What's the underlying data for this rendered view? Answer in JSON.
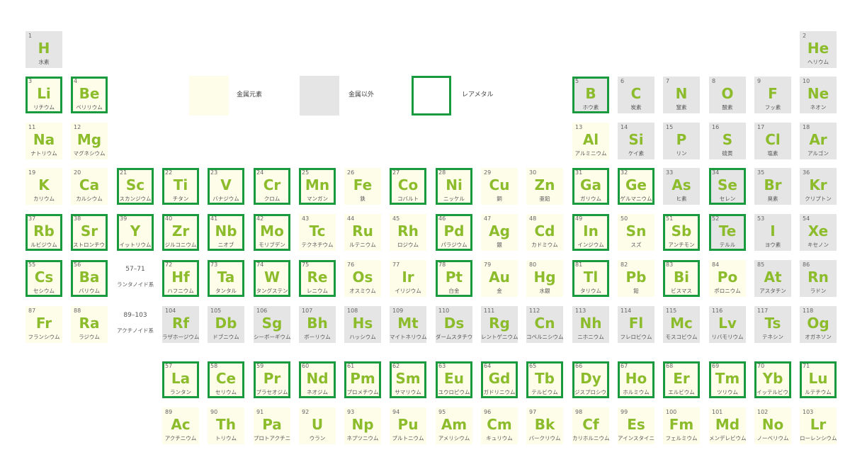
{
  "colors": {
    "metal_fill": "#fefdea",
    "nonmetal_fill": "#e5e5e5",
    "rare_border": "#1a9a3e",
    "symbol_text": "#8cbc2c"
  },
  "legend": [
    {
      "kind": "metal",
      "label": "金属元素"
    },
    {
      "kind": "nonmetal",
      "label": "金属以外"
    },
    {
      "kind": "rare",
      "label": "レアメタル"
    }
  ],
  "elements": [
    {
      "n": "1",
      "s": "H",
      "j": "水素",
      "c": "nonmetal",
      "r": false,
      "row": 1,
      "col": 1
    },
    {
      "n": "2",
      "s": "He",
      "j": "ヘリウム",
      "c": "nonmetal",
      "r": false,
      "row": 1,
      "col": 18
    },
    {
      "n": "3",
      "s": "Li",
      "j": "リチウム",
      "c": "metal",
      "r": true,
      "row": 2,
      "col": 1
    },
    {
      "n": "4",
      "s": "Be",
      "j": "ベリリウム",
      "c": "metal",
      "r": true,
      "row": 2,
      "col": 2
    },
    {
      "n": "5",
      "s": "B",
      "j": "ホウ素",
      "c": "nonmetal",
      "r": true,
      "row": 2,
      "col": 13
    },
    {
      "n": "6",
      "s": "C",
      "j": "炭素",
      "c": "nonmetal",
      "r": false,
      "row": 2,
      "col": 14
    },
    {
      "n": "7",
      "s": "N",
      "j": "窒素",
      "c": "nonmetal",
      "r": false,
      "row": 2,
      "col": 15
    },
    {
      "n": "8",
      "s": "O",
      "j": "酸素",
      "c": "nonmetal",
      "r": false,
      "row": 2,
      "col": 16
    },
    {
      "n": "9",
      "s": "F",
      "j": "フッ素",
      "c": "nonmetal",
      "r": false,
      "row": 2,
      "col": 17
    },
    {
      "n": "10",
      "s": "Ne",
      "j": "ネオン",
      "c": "nonmetal",
      "r": false,
      "row": 2,
      "col": 18
    },
    {
      "n": "11",
      "s": "Na",
      "j": "ナトリウム",
      "c": "metal",
      "r": false,
      "row": 3,
      "col": 1
    },
    {
      "n": "12",
      "s": "Mg",
      "j": "マグネシウム",
      "c": "metal",
      "r": false,
      "row": 3,
      "col": 2
    },
    {
      "n": "13",
      "s": "Al",
      "j": "アルミニウム",
      "c": "metal",
      "r": false,
      "row": 3,
      "col": 13
    },
    {
      "n": "14",
      "s": "Si",
      "j": "ケイ素",
      "c": "nonmetal",
      "r": false,
      "row": 3,
      "col": 14
    },
    {
      "n": "15",
      "s": "P",
      "j": "リン",
      "c": "nonmetal",
      "r": false,
      "row": 3,
      "col": 15
    },
    {
      "n": "16",
      "s": "S",
      "j": "硫黄",
      "c": "nonmetal",
      "r": false,
      "row": 3,
      "col": 16
    },
    {
      "n": "17",
      "s": "Cl",
      "j": "塩素",
      "c": "nonmetal",
      "r": false,
      "row": 3,
      "col": 17
    },
    {
      "n": "18",
      "s": "Ar",
      "j": "アルゴン",
      "c": "nonmetal",
      "r": false,
      "row": 3,
      "col": 18
    },
    {
      "n": "19",
      "s": "K",
      "j": "カリウム",
      "c": "metal",
      "r": false,
      "row": 4,
      "col": 1
    },
    {
      "n": "20",
      "s": "Ca",
      "j": "カルシウム",
      "c": "metal",
      "r": false,
      "row": 4,
      "col": 2
    },
    {
      "n": "21",
      "s": "Sc",
      "j": "スカンジウム",
      "c": "metal",
      "r": true,
      "row": 4,
      "col": 3
    },
    {
      "n": "22",
      "s": "Ti",
      "j": "チタン",
      "c": "metal",
      "r": true,
      "row": 4,
      "col": 4
    },
    {
      "n": "23",
      "s": "V",
      "j": "バナジウム",
      "c": "metal",
      "r": true,
      "row": 4,
      "col": 5
    },
    {
      "n": "24",
      "s": "Cr",
      "j": "クロム",
      "c": "metal",
      "r": true,
      "row": 4,
      "col": 6
    },
    {
      "n": "25",
      "s": "Mn",
      "j": "マンガン",
      "c": "metal",
      "r": true,
      "row": 4,
      "col": 7
    },
    {
      "n": "26",
      "s": "Fe",
      "j": "鉄",
      "c": "metal",
      "r": false,
      "row": 4,
      "col": 8
    },
    {
      "n": "27",
      "s": "Co",
      "j": "コバルト",
      "c": "metal",
      "r": true,
      "row": 4,
      "col": 9
    },
    {
      "n": "28",
      "s": "Ni",
      "j": "ニッケル",
      "c": "metal",
      "r": true,
      "row": 4,
      "col": 10
    },
    {
      "n": "29",
      "s": "Cu",
      "j": "銅",
      "c": "metal",
      "r": false,
      "row": 4,
      "col": 11
    },
    {
      "n": "30",
      "s": "Zn",
      "j": "亜鉛",
      "c": "metal",
      "r": false,
      "row": 4,
      "col": 12
    },
    {
      "n": "31",
      "s": "Ga",
      "j": "ガリウム",
      "c": "metal",
      "r": true,
      "row": 4,
      "col": 13
    },
    {
      "n": "32",
      "s": "Ge",
      "j": "ゲルマニウム",
      "c": "metal",
      "r": true,
      "row": 4,
      "col": 14
    },
    {
      "n": "33",
      "s": "As",
      "j": "ヒ素",
      "c": "nonmetal",
      "r": false,
      "row": 4,
      "col": 15
    },
    {
      "n": "34",
      "s": "Se",
      "j": "セレン",
      "c": "nonmetal",
      "r": true,
      "row": 4,
      "col": 16
    },
    {
      "n": "35",
      "s": "Br",
      "j": "臭素",
      "c": "nonmetal",
      "r": false,
      "row": 4,
      "col": 17
    },
    {
      "n": "36",
      "s": "Kr",
      "j": "クリプトン",
      "c": "nonmetal",
      "r": false,
      "row": 4,
      "col": 18
    },
    {
      "n": "37",
      "s": "Rb",
      "j": "ルビジウム",
      "c": "metal",
      "r": true,
      "row": 5,
      "col": 1
    },
    {
      "n": "38",
      "s": "Sr",
      "j": "ストロンチウム",
      "c": "metal",
      "r": true,
      "row": 5,
      "col": 2
    },
    {
      "n": "39",
      "s": "Y",
      "j": "イットリウム",
      "c": "metal",
      "r": true,
      "row": 5,
      "col": 3
    },
    {
      "n": "40",
      "s": "Zr",
      "j": "ジルコニウム",
      "c": "metal",
      "r": true,
      "row": 5,
      "col": 4
    },
    {
      "n": "41",
      "s": "Nb",
      "j": "ニオブ",
      "c": "metal",
      "r": true,
      "row": 5,
      "col": 5
    },
    {
      "n": "42",
      "s": "Mo",
      "j": "モリブデン",
      "c": "metal",
      "r": true,
      "row": 5,
      "col": 6
    },
    {
      "n": "43",
      "s": "Tc",
      "j": "テクネチウム",
      "c": "metal",
      "r": false,
      "row": 5,
      "col": 7
    },
    {
      "n": "44",
      "s": "Ru",
      "j": "ルテニウム",
      "c": "metal",
      "r": false,
      "row": 5,
      "col": 8
    },
    {
      "n": "45",
      "s": "Rh",
      "j": "ロジウム",
      "c": "metal",
      "r": false,
      "row": 5,
      "col": 9
    },
    {
      "n": "46",
      "s": "Pd",
      "j": "パラジウム",
      "c": "metal",
      "r": true,
      "row": 5,
      "col": 10
    },
    {
      "n": "47",
      "s": "Ag",
      "j": "銀",
      "c": "metal",
      "r": false,
      "row": 5,
      "col": 11
    },
    {
      "n": "48",
      "s": "Cd",
      "j": "カドミウム",
      "c": "metal",
      "r": false,
      "row": 5,
      "col": 12
    },
    {
      "n": "49",
      "s": "In",
      "j": "インジウム",
      "c": "metal",
      "r": true,
      "row": 5,
      "col": 13
    },
    {
      "n": "50",
      "s": "Sn",
      "j": "スズ",
      "c": "metal",
      "r": false,
      "row": 5,
      "col": 14
    },
    {
      "n": "51",
      "s": "Sb",
      "j": "アンチモン",
      "c": "metal",
      "r": true,
      "row": 5,
      "col": 15
    },
    {
      "n": "52",
      "s": "Te",
      "j": "テルル",
      "c": "nonmetal",
      "r": true,
      "row": 5,
      "col": 16
    },
    {
      "n": "53",
      "s": "I",
      "j": "ヨウ素",
      "c": "nonmetal",
      "r": false,
      "row": 5,
      "col": 17
    },
    {
      "n": "54",
      "s": "Xe",
      "j": "キセノン",
      "c": "nonmetal",
      "r": false,
      "row": 5,
      "col": 18
    },
    {
      "n": "55",
      "s": "Cs",
      "j": "セシウム",
      "c": "metal",
      "r": true,
      "row": 6,
      "col": 1
    },
    {
      "n": "56",
      "s": "Ba",
      "j": "バリウム",
      "c": "metal",
      "r": true,
      "row": 6,
      "col": 2
    },
    {
      "n": "57–71",
      "s": "",
      "j": "ランタノイド系",
      "c": "blank",
      "r": false,
      "row": 6,
      "col": 3,
      "range": true
    },
    {
      "n": "72",
      "s": "Hf",
      "j": "ハフニウム",
      "c": "metal",
      "r": true,
      "row": 6,
      "col": 4
    },
    {
      "n": "73",
      "s": "Ta",
      "j": "タンタル",
      "c": "metal",
      "r": true,
      "row": 6,
      "col": 5
    },
    {
      "n": "74",
      "s": "W",
      "j": "タングステン",
      "c": "metal",
      "r": true,
      "row": 6,
      "col": 6
    },
    {
      "n": "75",
      "s": "Re",
      "j": "レニウム",
      "c": "metal",
      "r": true,
      "row": 6,
      "col": 7
    },
    {
      "n": "76",
      "s": "Os",
      "j": "オスミウム",
      "c": "metal",
      "r": false,
      "row": 6,
      "col": 8
    },
    {
      "n": "77",
      "s": "Ir",
      "j": "イリジウム",
      "c": "metal",
      "r": false,
      "row": 6,
      "col": 9
    },
    {
      "n": "78",
      "s": "Pt",
      "j": "白金",
      "c": "metal",
      "r": true,
      "row": 6,
      "col": 10
    },
    {
      "n": "79",
      "s": "Au",
      "j": "金",
      "c": "metal",
      "r": false,
      "row": 6,
      "col": 11
    },
    {
      "n": "80",
      "s": "Hg",
      "j": "水銀",
      "c": "metal",
      "r": false,
      "row": 6,
      "col": 12
    },
    {
      "n": "81",
      "s": "Tl",
      "j": "タリウム",
      "c": "metal",
      "r": true,
      "row": 6,
      "col": 13
    },
    {
      "n": "82",
      "s": "Pb",
      "j": "鉛",
      "c": "metal",
      "r": false,
      "row": 6,
      "col": 14
    },
    {
      "n": "83",
      "s": "Bi",
      "j": "ビスマス",
      "c": "metal",
      "r": true,
      "row": 6,
      "col": 15
    },
    {
      "n": "84",
      "s": "Po",
      "j": "ポロニウム",
      "c": "metal",
      "r": false,
      "row": 6,
      "col": 16
    },
    {
      "n": "85",
      "s": "At",
      "j": "アスタチン",
      "c": "nonmetal",
      "r": false,
      "row": 6,
      "col": 17
    },
    {
      "n": "86",
      "s": "Rn",
      "j": "ラドン",
      "c": "nonmetal",
      "r": false,
      "row": 6,
      "col": 18
    },
    {
      "n": "87",
      "s": "Fr",
      "j": "フランシウム",
      "c": "metal",
      "r": false,
      "row": 7,
      "col": 1
    },
    {
      "n": "88",
      "s": "Ra",
      "j": "ラジウム",
      "c": "metal",
      "r": false,
      "row": 7,
      "col": 2
    },
    {
      "n": "89–103",
      "s": "",
      "j": "アクチノイド系",
      "c": "blank",
      "r": false,
      "row": 7,
      "col": 3,
      "range": true
    },
    {
      "n": "104",
      "s": "Rf",
      "j": "ラザホージウム",
      "c": "nonmetal",
      "r": false,
      "row": 7,
      "col": 4
    },
    {
      "n": "105",
      "s": "Db",
      "j": "ドブニウム",
      "c": "nonmetal",
      "r": false,
      "row": 7,
      "col": 5
    },
    {
      "n": "106",
      "s": "Sg",
      "j": "シーボーギウム",
      "c": "nonmetal",
      "r": false,
      "row": 7,
      "col": 6
    },
    {
      "n": "107",
      "s": "Bh",
      "j": "ボーリウム",
      "c": "nonmetal",
      "r": false,
      "row": 7,
      "col": 7
    },
    {
      "n": "108",
      "s": "Hs",
      "j": "ハッシウム",
      "c": "nonmetal",
      "r": false,
      "row": 7,
      "col": 8
    },
    {
      "n": "109",
      "s": "Mt",
      "j": "マイトネリウム",
      "c": "nonmetal",
      "r": false,
      "row": 7,
      "col": 9
    },
    {
      "n": "110",
      "s": "Ds",
      "j": "ダームスタチウム",
      "c": "nonmetal",
      "r": false,
      "row": 7,
      "col": 10
    },
    {
      "n": "111",
      "s": "Rg",
      "j": "レントゲニウム",
      "c": "nonmetal",
      "r": false,
      "row": 7,
      "col": 11
    },
    {
      "n": "112",
      "s": "Cn",
      "j": "コペルニシウム",
      "c": "nonmetal",
      "r": false,
      "row": 7,
      "col": 12
    },
    {
      "n": "113",
      "s": "Nh",
      "j": "ニホニウム",
      "c": "nonmetal",
      "r": false,
      "row": 7,
      "col": 13
    },
    {
      "n": "114",
      "s": "Fl",
      "j": "フレロビウム",
      "c": "nonmetal",
      "r": false,
      "row": 7,
      "col": 14
    },
    {
      "n": "115",
      "s": "Mc",
      "j": "モスコビウム",
      "c": "nonmetal",
      "r": false,
      "row": 7,
      "col": 15
    },
    {
      "n": "116",
      "s": "Lv",
      "j": "リバモリウム",
      "c": "nonmetal",
      "r": false,
      "row": 7,
      "col": 16
    },
    {
      "n": "117",
      "s": "Ts",
      "j": "テネシン",
      "c": "nonmetal",
      "r": false,
      "row": 7,
      "col": 17
    },
    {
      "n": "118",
      "s": "Og",
      "j": "オガネソン",
      "c": "nonmetal",
      "r": false,
      "row": 7,
      "col": 18
    },
    {
      "n": "57",
      "s": "La",
      "j": "ランタン",
      "c": "metal",
      "r": true,
      "row": 8,
      "col": 4
    },
    {
      "n": "58",
      "s": "Ce",
      "j": "セリウム",
      "c": "metal",
      "r": true,
      "row": 8,
      "col": 5
    },
    {
      "n": "59",
      "s": "Pr",
      "j": "プラセオジム",
      "c": "metal",
      "r": true,
      "row": 8,
      "col": 6
    },
    {
      "n": "60",
      "s": "Nd",
      "j": "ネオジム",
      "c": "metal",
      "r": true,
      "row": 8,
      "col": 7
    },
    {
      "n": "61",
      "s": "Pm",
      "j": "プロメチウム",
      "c": "metal",
      "r": true,
      "row": 8,
      "col": 8
    },
    {
      "n": "62",
      "s": "Sm",
      "j": "サマリウム",
      "c": "metal",
      "r": true,
      "row": 8,
      "col": 9
    },
    {
      "n": "63",
      "s": "Eu",
      "j": "ユウロピウム",
      "c": "metal",
      "r": true,
      "row": 8,
      "col": 10
    },
    {
      "n": "64",
      "s": "Gd",
      "j": "ガドリニウム",
      "c": "metal",
      "r": true,
      "row": 8,
      "col": 11
    },
    {
      "n": "65",
      "s": "Tb",
      "j": "テルビウム",
      "c": "metal",
      "r": true,
      "row": 8,
      "col": 12
    },
    {
      "n": "66",
      "s": "Dy",
      "j": "ジスプロシウム",
      "c": "metal",
      "r": true,
      "row": 8,
      "col": 13
    },
    {
      "n": "67",
      "s": "Ho",
      "j": "ホルミウム",
      "c": "metal",
      "r": true,
      "row": 8,
      "col": 14
    },
    {
      "n": "68",
      "s": "Er",
      "j": "エルビウム",
      "c": "metal",
      "r": true,
      "row": 8,
      "col": 15
    },
    {
      "n": "69",
      "s": "Tm",
      "j": "ツリウム",
      "c": "metal",
      "r": true,
      "row": 8,
      "col": 16
    },
    {
      "n": "70",
      "s": "Yb",
      "j": "イッテルビウム",
      "c": "metal",
      "r": true,
      "row": 8,
      "col": 17
    },
    {
      "n": "71",
      "s": "Lu",
      "j": "ルテチウム",
      "c": "metal",
      "r": true,
      "row": 8,
      "col": 18
    },
    {
      "n": "89",
      "s": "Ac",
      "j": "アクチニウム",
      "c": "metal",
      "r": false,
      "row": 9,
      "col": 4
    },
    {
      "n": "90",
      "s": "Th",
      "j": "トリウム",
      "c": "metal",
      "r": false,
      "row": 9,
      "col": 5
    },
    {
      "n": "91",
      "s": "Pa",
      "j": "プロトアクチニウム",
      "c": "metal",
      "r": false,
      "row": 9,
      "col": 6
    },
    {
      "n": "92",
      "s": "U",
      "j": "ウラン",
      "c": "metal",
      "r": false,
      "row": 9,
      "col": 7
    },
    {
      "n": "93",
      "s": "Np",
      "j": "ネプツニウム",
      "c": "metal",
      "r": false,
      "row": 9,
      "col": 8
    },
    {
      "n": "94",
      "s": "Pu",
      "j": "プルトニウム",
      "c": "metal",
      "r": false,
      "row": 9,
      "col": 9
    },
    {
      "n": "95",
      "s": "Am",
      "j": "アメリシウム",
      "c": "metal",
      "r": false,
      "row": 9,
      "col": 10
    },
    {
      "n": "96",
      "s": "Cm",
      "j": "キュリウム",
      "c": "metal",
      "r": false,
      "row": 9,
      "col": 11
    },
    {
      "n": "97",
      "s": "Bk",
      "j": "バークリウム",
      "c": "metal",
      "r": false,
      "row": 9,
      "col": 12
    },
    {
      "n": "98",
      "s": "Cf",
      "j": "カリホルニウム",
      "c": "metal",
      "r": false,
      "row": 9,
      "col": 13
    },
    {
      "n": "99",
      "s": "Es",
      "j": "アインスタイニウム",
      "c": "metal",
      "r": false,
      "row": 9,
      "col": 14
    },
    {
      "n": "100",
      "s": "Fm",
      "j": "フェルミウム",
      "c": "metal",
      "r": false,
      "row": 9,
      "col": 15
    },
    {
      "n": "101",
      "s": "Md",
      "j": "メンデレビウム",
      "c": "metal",
      "r": false,
      "row": 9,
      "col": 16
    },
    {
      "n": "102",
      "s": "No",
      "j": "ノーベリウム",
      "c": "metal",
      "r": false,
      "row": 9,
      "col": 17
    },
    {
      "n": "103",
      "s": "Lr",
      "j": "ローレンシウム",
      "c": "metal",
      "r": false,
      "row": 9,
      "col": 18
    }
  ]
}
